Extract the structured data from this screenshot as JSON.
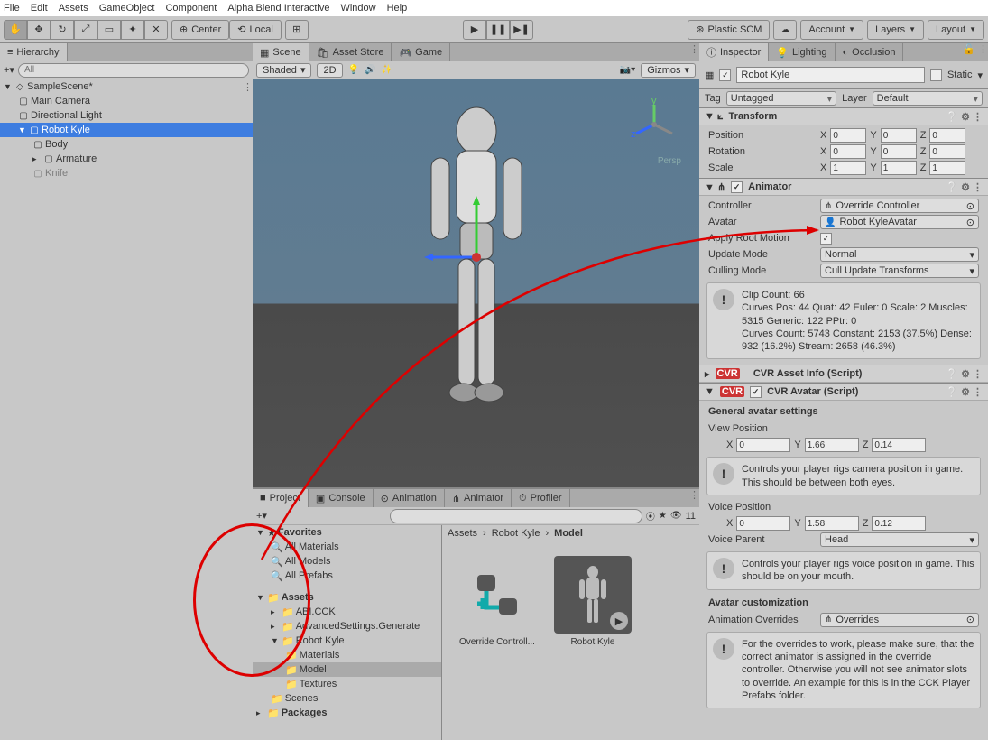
{
  "menu": {
    "items": [
      "File",
      "Edit",
      "Assets",
      "GameObject",
      "Component",
      "Alpha Blend Interactive",
      "Window",
      "Help"
    ]
  },
  "toolbar": {
    "center": "Center",
    "local": "Local",
    "plastic": "Plastic SCM",
    "account": "Account",
    "layers": "Layers",
    "layout": "Layout"
  },
  "hierarchy": {
    "title": "Hierarchy",
    "search_placeholder": "All",
    "scene": "SampleScene*",
    "items": [
      "Main Camera",
      "Directional Light",
      "Robot Kyle",
      "Body",
      "Armature",
      "Knife"
    ]
  },
  "scene_tabs": {
    "scene": "Scene",
    "asset_store": "Asset Store",
    "game": "Game"
  },
  "scene_toolbar": {
    "shaded": "Shaded",
    "twod": "2D",
    "gizmos": "Gizmos"
  },
  "persp": "Persp",
  "bottom_tabs": {
    "project": "Project",
    "console": "Console",
    "animation": "Animation",
    "animator": "Animator",
    "profiler": "Profiler"
  },
  "project": {
    "favorites": "Favorites",
    "fav_items": [
      "All Materials",
      "All Models",
      "All Prefabs"
    ],
    "assets": "Assets",
    "folders": [
      "ABI.CCK",
      "AdvancedSettings.Generate",
      "Robot Kyle",
      "Materials",
      "Model",
      "Textures",
      "Scenes"
    ],
    "packages": "Packages",
    "breadcrumb": [
      "Assets",
      "Robot Kyle",
      "Model"
    ],
    "items": [
      "Override Controll...",
      "Robot Kyle"
    ],
    "count": "11"
  },
  "inspector": {
    "tabs": {
      "inspector": "Inspector",
      "lighting": "Lighting",
      "occlusion": "Occlusion"
    },
    "name": "Robot Kyle",
    "static": "Static",
    "tag_label": "Tag",
    "tag": "Untagged",
    "layer_label": "Layer",
    "layer": "Default",
    "transform": {
      "title": "Transform",
      "position": "Position",
      "pos": {
        "x": "0",
        "y": "0",
        "z": "0"
      },
      "rotation": "Rotation",
      "rot": {
        "x": "0",
        "y": "0",
        "z": "0"
      },
      "scale": "Scale",
      "scl": {
        "x": "1",
        "y": "1",
        "z": "1"
      }
    },
    "animator": {
      "title": "Animator",
      "controller_label": "Controller",
      "controller": "Override Controller",
      "avatar_label": "Avatar",
      "avatar": "Robot KyleAvatar",
      "root_motion": "Apply Root Motion",
      "update_mode_label": "Update Mode",
      "update_mode": "Normal",
      "culling_label": "Culling Mode",
      "culling": "Cull Update Transforms",
      "info": "Clip Count: 66\nCurves Pos: 44 Quat: 42 Euler: 0 Scale: 2 Muscles: 5315 Generic: 122 PPtr: 0\nCurves Count: 5743 Constant: 2153 (37.5%) Dense: 932 (16.2%) Stream: 2658 (46.3%)"
    },
    "cvr_asset": "CVR Asset Info (Script)",
    "cvr_avatar": {
      "title": "CVR Avatar (Script)",
      "general": "General avatar settings",
      "view_pos": "View Position",
      "view": {
        "x": "0",
        "y": "1.66",
        "z": "0.14"
      },
      "view_info": "Controls your player rigs camera position in game. This should be between both eyes.",
      "voice_pos": "Voice Position",
      "voice": {
        "x": "0",
        "y": "1.58",
        "z": "0.12"
      },
      "voice_parent_label": "Voice Parent",
      "voice_parent": "Head",
      "voice_info": "Controls your player rigs voice position in game. This should be on your mouth.",
      "custom": "Avatar customization",
      "overrides_label": "Animation Overrides",
      "overrides": "Overrides",
      "overrides_info": "For the overrides to work, please make sure, that the correct animator is assigned in the override controller. Otherwise you will not see animator slots to override. An example for this is in the CCK Player Prefabs folder."
    }
  }
}
